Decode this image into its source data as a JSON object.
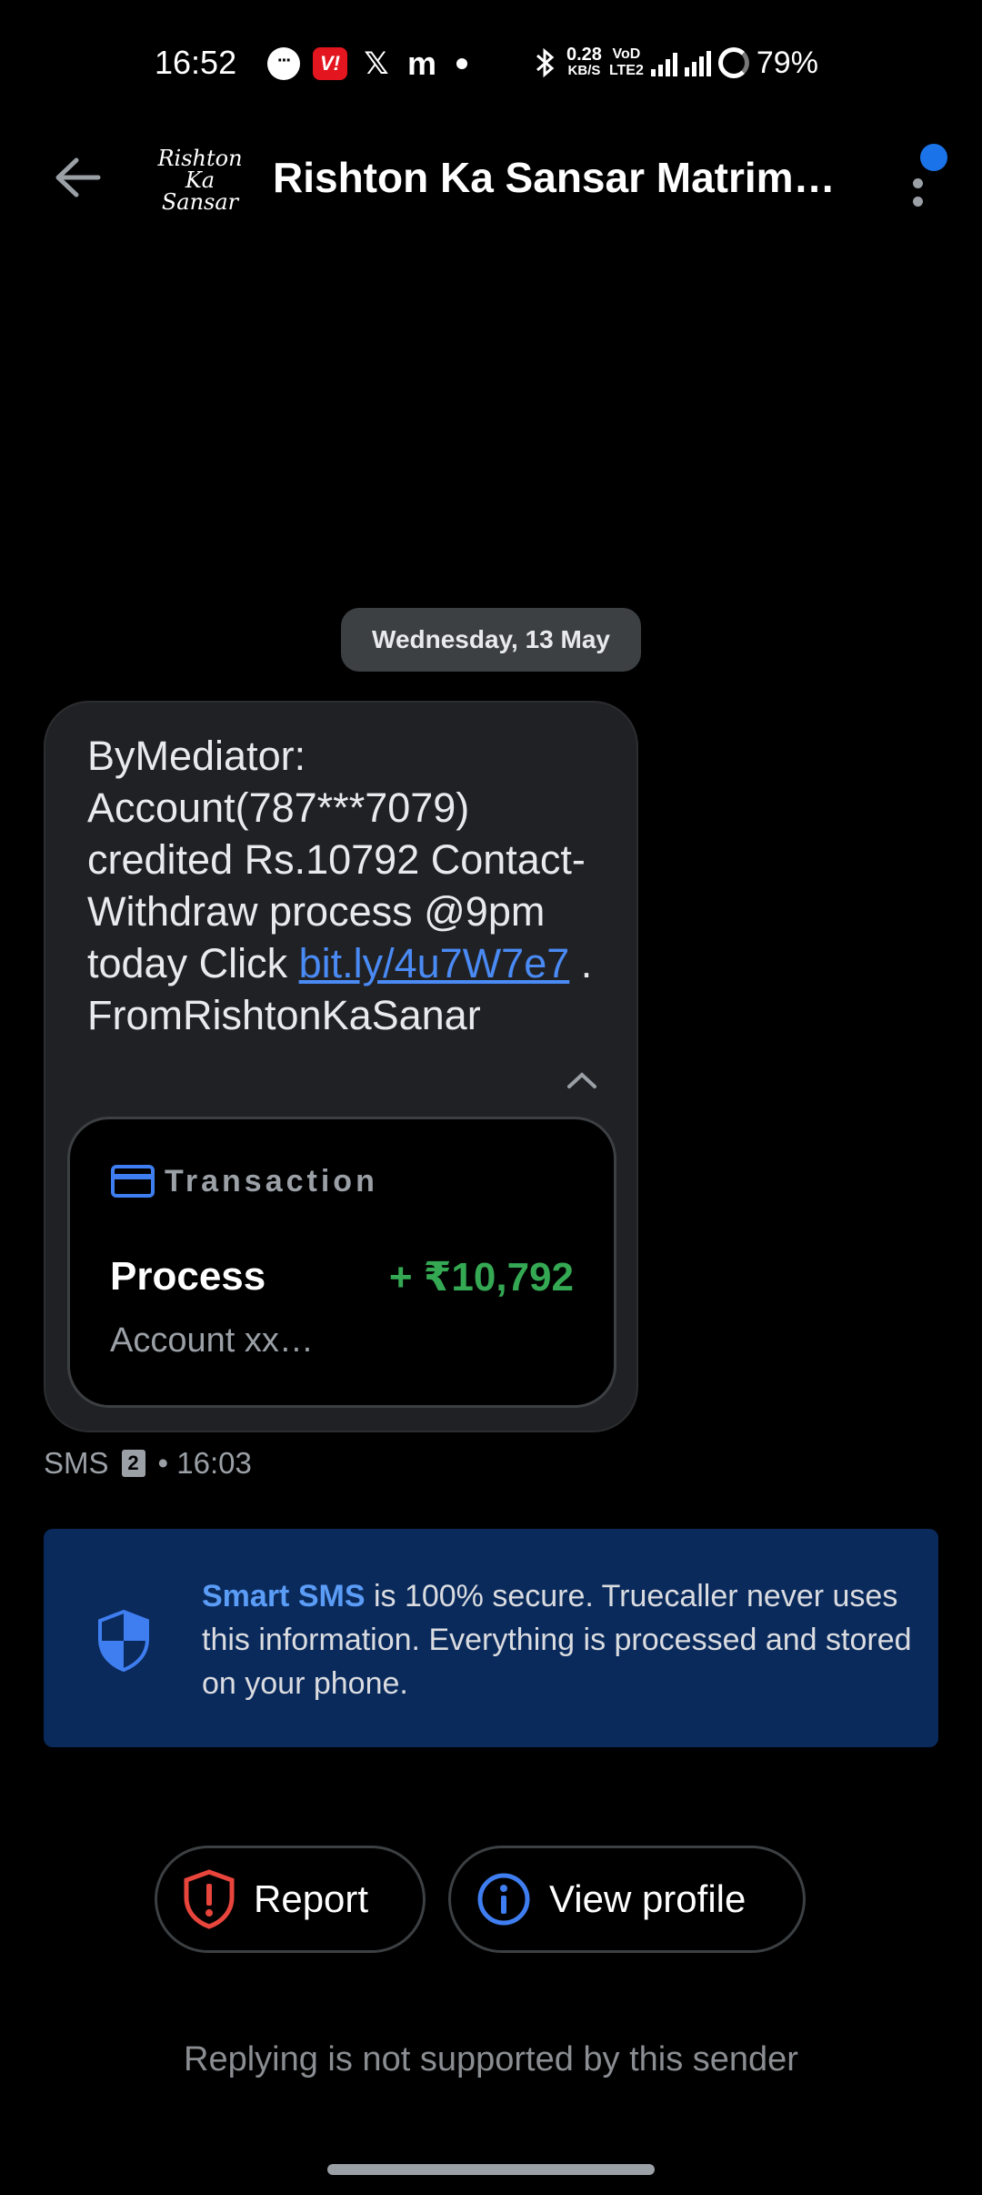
{
  "status_bar": {
    "time": "16:52",
    "data_speed_value": "0.28",
    "data_speed_unit": "KB/S",
    "volte_top": "VoD",
    "volte_bottom": "LTE2",
    "battery": "79%"
  },
  "header": {
    "logo_text": "Rishton Ka Sansar",
    "title": "Rishton Ka Sansar Matrimony",
    "menu_badge_color": "#1a73e8"
  },
  "date_chip": "Wednesday, 13 May",
  "message": {
    "text_before_link": "ByMediator: Account(787***7079) credited Rs.10792 Contact- Withdraw process @9pm today Click ",
    "link": "bit.ly/4u7W7e7",
    "text_after_link": " . FromRishtonKaSanar"
  },
  "transaction": {
    "header_label": "Transaction",
    "title": "Process",
    "amount": "+ ₹10,792",
    "account": "Account xx…",
    "amount_color": "#34a853"
  },
  "meta": {
    "channel": "SMS",
    "sim": "2",
    "time": "• 16:03"
  },
  "smart_sms": {
    "brand": "Smart SMS",
    "text": " is 100% secure. Truecaller never uses this information. Everything is processed and stored on your phone."
  },
  "actions": {
    "report_label": "Report",
    "view_profile_label": "View profile"
  },
  "footer_note": "Replying is not supported by this sender"
}
